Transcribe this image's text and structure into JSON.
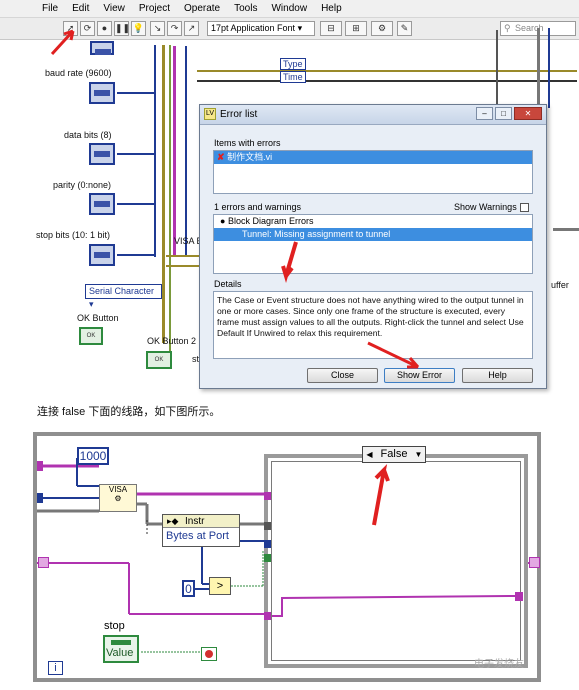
{
  "top_screenshot": {
    "menu": [
      "File",
      "Edit",
      "View",
      "Project",
      "Operate",
      "Tools",
      "Window",
      "Help"
    ],
    "toolbar": {
      "font": "17pt Application Font",
      "search_placeholder": "Search"
    },
    "controls": {
      "baud_rate": "baud rate (9600)",
      "data_bits": "data bits (8)",
      "parity": "parity (0:none)",
      "stop_bits": "stop bits (10: 1 bit)",
      "visa_label": "VISA E",
      "serial_character": "Serial Character",
      "ok_button": "OK Button",
      "ok_button_2": "OK Button 2",
      "type": "Type",
      "time": "Time",
      "buffer_fragment": "uffer",
      "sto_fragment": "sto"
    },
    "error_dialog": {
      "title": "Error list",
      "items_label": "Items with errors",
      "item_selected": "制作文档.vi",
      "summary": "1 errors and warnings",
      "show_warnings": "Show Warnings",
      "tree_parent": "Block Diagram Errors",
      "tree_child": "Tunnel: Missing assignment to tunnel",
      "details_label": "Details",
      "details_text": "The Case or Event structure does not have anything wired to the output tunnel in one or more cases. Since only one frame of the structure is executed, every frame must assign values to all the outputs.  Right-click the tunnel and select Use Default If Unwired to relax this requirement.",
      "buttons": {
        "close": "Close",
        "show_error": "Show Error",
        "help": "Help"
      }
    }
  },
  "caption": "连接 false 下面的线路，如下图所示。",
  "bottom_screenshot": {
    "const_1000": "1000",
    "visa_node": "VISA",
    "property_node_title": "Instr",
    "property_node_row": "Bytes at Port",
    "const_0": "0",
    "compare_symbol": ">",
    "case_selector_value": "False",
    "stop_label": "stop",
    "stop_value": "Value",
    "iteration_terminal": "i",
    "watermark": "电子发烧友"
  },
  "colors": {
    "error_red": "#e02020",
    "selection_blue": "#3d8ee0"
  }
}
